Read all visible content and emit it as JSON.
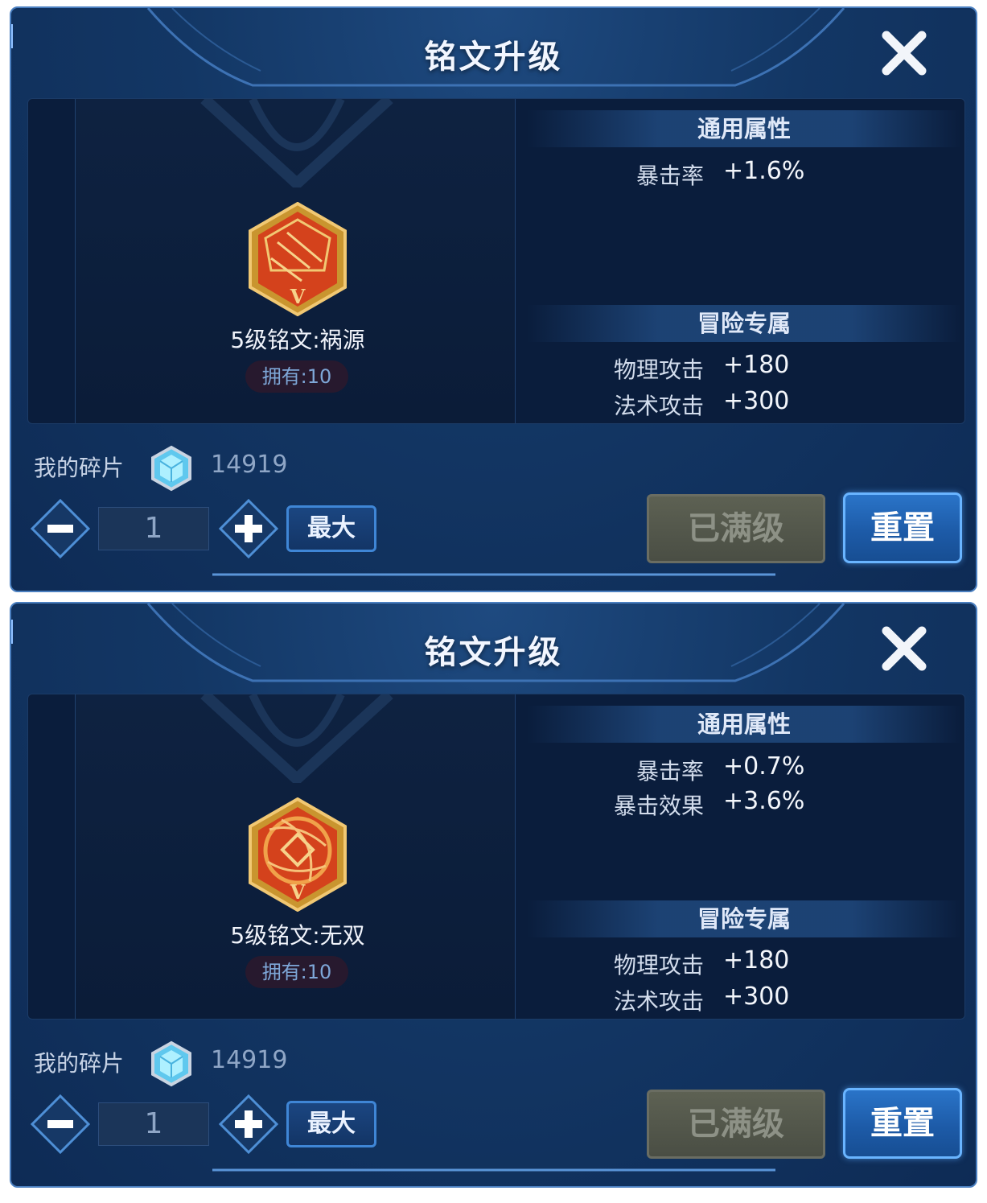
{
  "panels": [
    {
      "title": "铭文升级",
      "rune_name": "5级铭文:祸源",
      "owned": "拥有:10",
      "rune_level_mark": "V",
      "general_header": "通用属性",
      "general_attrs": [
        {
          "name": "暴击率",
          "value": "+1.6%"
        }
      ],
      "adventure_header": "冒险专属",
      "adventure_attrs": [
        {
          "name": "物理攻击",
          "value": "+180"
        },
        {
          "name": "法术攻击",
          "value": "+300"
        }
      ],
      "fragments_label": "我的碎片",
      "fragments_value": "14919",
      "quantity": "1",
      "max_label": "最大",
      "maxed_label": "已满级",
      "reset_label": "重置"
    },
    {
      "title": "铭文升级",
      "rune_name": "5级铭文:无双",
      "owned": "拥有:10",
      "rune_level_mark": "V",
      "general_header": "通用属性",
      "general_attrs": [
        {
          "name": "暴击率",
          "value": "+0.7%"
        },
        {
          "name": "暴击效果",
          "value": "+3.6%"
        }
      ],
      "adventure_header": "冒险专属",
      "adventure_attrs": [
        {
          "name": "物理攻击",
          "value": "+180"
        },
        {
          "name": "法术攻击",
          "value": "+300"
        }
      ],
      "fragments_label": "我的碎片",
      "fragments_value": "14919",
      "quantity": "1",
      "max_label": "最大",
      "maxed_label": "已满级",
      "reset_label": "重置"
    }
  ],
  "icons": {
    "close": "close-icon",
    "rune_0": "rune-huoyuan-icon",
    "rune_1": "rune-wushuang-icon",
    "fragment": "fragment-crystal-icon",
    "minus": "minus-icon",
    "plus": "plus-icon"
  },
  "colors": {
    "panel_bg": "#133765",
    "panel_border": "#4a7fc0",
    "rune_orange": "#e0471e",
    "rune_gold": "#e8b75c",
    "reset_blue": "#2a74c8",
    "maxed_gray": "#5d6153"
  }
}
